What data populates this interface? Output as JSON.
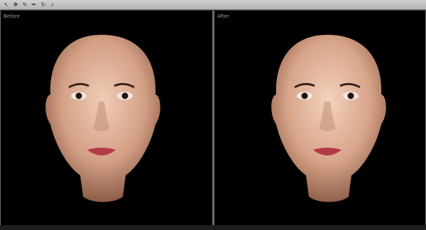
{
  "toolbar": {
    "tools": [
      {
        "name": "select-tool-icon",
        "glyph": "↖"
      },
      {
        "name": "move-tool-icon",
        "glyph": "✥"
      },
      {
        "name": "brush-tool-icon",
        "glyph": "✎"
      },
      {
        "name": "pen-tool-icon",
        "glyph": "✒"
      },
      {
        "name": "rotate-tool-icon",
        "glyph": "↻"
      },
      {
        "name": "zoom-tool-icon",
        "glyph": "⌕"
      }
    ]
  },
  "panes": {
    "before_label": "Before",
    "after_label": "After"
  },
  "colors": {
    "viewport_bg": "#000000",
    "skin_before": "#d6a48b",
    "skin_after": "#dca68e",
    "lips": "#b23a49"
  }
}
